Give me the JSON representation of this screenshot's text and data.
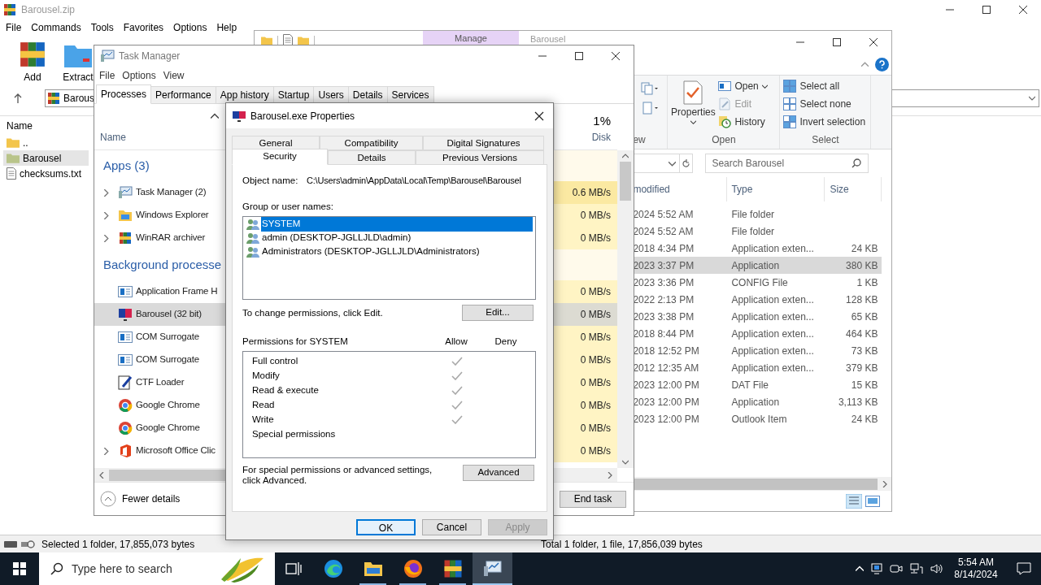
{
  "winrar": {
    "title": "Barousel.zip",
    "menu": [
      "File",
      "Commands",
      "Tools",
      "Favorites",
      "Options",
      "Help"
    ],
    "toolbar": [
      {
        "label": "Add"
      },
      {
        "label": "Extract"
      }
    ],
    "address": "Barous",
    "list_header": "Name",
    "files": [
      {
        "name": "..",
        "selected": false
      },
      {
        "name": "Barousel",
        "selected": true
      },
      {
        "name": "checksums.txt",
        "selected": false
      }
    ],
    "status_left": "Selected 1 folder, 17,855,073 bytes",
    "status_right": "Total 1 folder, 1 file, 17,856,039 bytes"
  },
  "explorer": {
    "context_tab": "Manage",
    "title": "Barousel",
    "ribbon": {
      "new_group": "ew",
      "properties": "Properties",
      "open": "Open",
      "edit": "Edit",
      "history": "History",
      "open_group": "Open",
      "select_all": "Select all",
      "select_none": "Select none",
      "invert_selection": "Invert selection",
      "select_group": "Select"
    },
    "search": {
      "placeholder": "Search Barousel"
    },
    "columns": [
      "modified",
      "Type",
      "Size"
    ],
    "rows": [
      {
        "modified": "2024 5:52 AM",
        "type": "File folder",
        "selected": false
      },
      {
        "modified": "2024 5:52 AM",
        "type": "File folder",
        "selected": false
      },
      {
        "modified": "2018 4:34 PM",
        "type": "Application exten...",
        "size": "24 KB",
        "selected": false
      },
      {
        "modified": "2023 3:37 PM",
        "type": "Application",
        "size": "380 KB",
        "selected": true
      },
      {
        "modified": "2023 3:36 PM",
        "type": "CONFIG File",
        "size": "1 KB",
        "selected": false
      },
      {
        "modified": "2022 2:13 PM",
        "type": "Application exten...",
        "size": "128 KB",
        "selected": false
      },
      {
        "modified": "2023 3:38 PM",
        "type": "Application exten...",
        "size": "65 KB",
        "selected": false
      },
      {
        "modified": "2018 8:44 PM",
        "type": "Application exten...",
        "size": "464 KB",
        "selected": false
      },
      {
        "modified": "2018 12:52 PM",
        "type": "Application exten...",
        "size": "73 KB",
        "selected": false
      },
      {
        "modified": "2012 12:35 AM",
        "type": "Application exten...",
        "size": "379 KB",
        "selected": false
      },
      {
        "modified": "2023 12:00 PM",
        "type": "DAT File",
        "size": "15 KB",
        "selected": false
      },
      {
        "modified": "2023 12:00 PM",
        "type": "Application",
        "size": "3,113 KB",
        "selected": false
      },
      {
        "modified": "2023 12:00 PM",
        "type": "Outlook Item",
        "size": "24 KB",
        "selected": false
      }
    ]
  },
  "task_manager": {
    "title": "Task Manager",
    "menu": [
      "File",
      "Options",
      "View"
    ],
    "tabs": [
      {
        "label": "Processes",
        "selected": true
      },
      {
        "label": "Performance",
        "selected": false
      },
      {
        "label": "App history",
        "selected": false
      },
      {
        "label": "Startup",
        "selected": false
      },
      {
        "label": "Users",
        "selected": false
      },
      {
        "label": "Details",
        "selected": false
      },
      {
        "label": "Services",
        "selected": false
      }
    ],
    "name_header": "Name",
    "disk_header": {
      "percent": "1%",
      "label": "Disk"
    },
    "groups": [
      {
        "title": "Apps (3)",
        "items": [
          {
            "name": "Task Manager (2)",
            "expandable": true,
            "disk": "0.6 MB/s",
            "color": "#fbe9a2",
            "selected": false
          },
          {
            "name": "Windows Explorer",
            "expandable": true,
            "disk": "0 MB/s",
            "color": "#fff4c4",
            "selected": false
          },
          {
            "name": "WinRAR archiver",
            "expandable": true,
            "disk": "0 MB/s",
            "color": "#fff4c4",
            "selected": false
          }
        ]
      },
      {
        "title": "Background processe",
        "items": [
          {
            "name": "Application Frame H",
            "expandable": false,
            "disk": "0 MB/s",
            "color": "#fff4c4",
            "selected": false
          },
          {
            "name": "Barousel (32 bit)",
            "expandable": false,
            "disk": "0 MB/s",
            "selected": true
          },
          {
            "name": "COM Surrogate",
            "expandable": false,
            "disk": "0 MB/s",
            "color": "#fff4c4",
            "selected": false
          },
          {
            "name": "COM Surrogate",
            "expandable": false,
            "disk": "0 MB/s",
            "color": "#fff4c4",
            "selected": false
          },
          {
            "name": "CTF Loader",
            "expandable": false,
            "disk": "0 MB/s",
            "color": "#fff4c4",
            "selected": false
          },
          {
            "name": "Google Chrome",
            "expandable": false,
            "disk": "0 MB/s",
            "color": "#fff4c4",
            "selected": false
          },
          {
            "name": "Google Chrome",
            "expandable": false,
            "disk": "0 MB/s",
            "color": "#fff4c4",
            "selected": false
          },
          {
            "name": "Microsoft Office Clic",
            "expandable": true,
            "disk": "0 MB/s",
            "color": "#fff4c4",
            "selected": false
          }
        ]
      }
    ],
    "fewer_details": "Fewer details",
    "end_task": "End task"
  },
  "properties_dialog": {
    "title": "Barousel.exe Properties",
    "tab_rows": [
      [
        {
          "label": "General",
          "selected": false
        },
        {
          "label": "Compatibility",
          "selected": false
        },
        {
          "label": "Digital Signatures",
          "selected": false
        }
      ],
      [
        {
          "label": "Security",
          "selected": true
        },
        {
          "label": "Details",
          "selected": false
        },
        {
          "label": "Previous Versions",
          "selected": false
        }
      ]
    ],
    "object_name_label": "Object name:",
    "object_name": "C:\\Users\\admin\\AppData\\Local\\Temp\\Barousel\\Barousel",
    "group_label": "Group or user names:",
    "users": [
      {
        "name": "SYSTEM",
        "selected": true
      },
      {
        "name": "admin (DESKTOP-JGLLJLD\\admin)",
        "selected": false
      },
      {
        "name": "Administrators (DESKTOP-JGLLJLD\\Administrators)",
        "selected": false
      }
    ],
    "edit_hint": "To change permissions, click Edit.",
    "edit_button": "Edit...",
    "permissions_label": "Permissions for SYSTEM",
    "allow_header": "Allow",
    "deny_header": "Deny",
    "permissions": [
      {
        "name": "Full control",
        "allow": true,
        "deny": false
      },
      {
        "name": "Modify",
        "allow": true,
        "deny": false
      },
      {
        "name": "Read & execute",
        "allow": true,
        "deny": false
      },
      {
        "name": "Read",
        "allow": true,
        "deny": false
      },
      {
        "name": "Write",
        "allow": true,
        "deny": false
      },
      {
        "name": "Special permissions",
        "allow": false,
        "deny": false
      }
    ],
    "advanced_hint": "For special permissions or advanced settings, click Advanced.",
    "advanced_button": "Advanced",
    "buttons": [
      {
        "label": "OK",
        "default": true,
        "disabled": false
      },
      {
        "label": "Cancel",
        "default": false,
        "disabled": false
      },
      {
        "label": "Apply",
        "default": false,
        "disabled": true
      }
    ]
  },
  "taskbar": {
    "search": {
      "placeholder": "Type here to search"
    },
    "apps": [
      {
        "running": false,
        "selected": false
      },
      {
        "running": false,
        "selected": false
      },
      {
        "running": true,
        "selected": false
      },
      {
        "running": true,
        "selected": false
      },
      {
        "running": true,
        "selected": false
      },
      {
        "running": true,
        "selected": true
      }
    ],
    "clock": {
      "time": "5:54 AM",
      "date": "8/14/2024"
    }
  }
}
